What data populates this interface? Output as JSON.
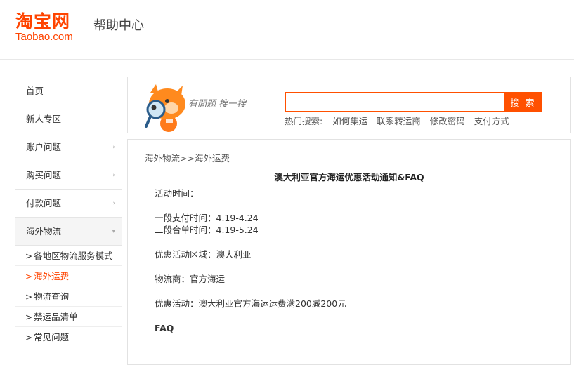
{
  "header": {
    "logo_cn": "淘宝网",
    "logo_en": "Taobao.com",
    "site_title": "帮助中心"
  },
  "sidebar": {
    "items": [
      {
        "label": "首页"
      },
      {
        "label": "新人专区"
      },
      {
        "label": "账户问题"
      },
      {
        "label": "购买问题"
      },
      {
        "label": "付款问题"
      },
      {
        "label": "海外物流"
      }
    ],
    "sub_items": [
      {
        "label": "各地区物流服务模式"
      },
      {
        "label": "海外运费"
      },
      {
        "label": "物流查询"
      },
      {
        "label": "禁运品清单"
      },
      {
        "label": "常见问题"
      }
    ]
  },
  "search": {
    "slogan": "有問题 搜一搜",
    "input_value": "",
    "button_label": "搜 索",
    "hot_label": "热门搜索:",
    "hot_links": [
      "如何集运",
      "联系转运商",
      "修改密码",
      "支付方式"
    ]
  },
  "article": {
    "breadcrumb": "海外物流>>海外运费",
    "title": "澳大利亚官方海运优惠活动通知&FAQ",
    "lines": {
      "time_label": "活动时间：",
      "phase1": "一段支付时间：4.19-4.24",
      "phase2": "二段合单时间：4.19-5.24",
      "region": "优惠活动区域：澳大利亚",
      "carrier": "物流商：官方海运",
      "promo": "优惠活动：澳大利亚官方海运运费满200减200元",
      "faq": "FAQ"
    }
  },
  "colors": {
    "brand": "#ff4400",
    "search_accent": "#ff5000"
  }
}
